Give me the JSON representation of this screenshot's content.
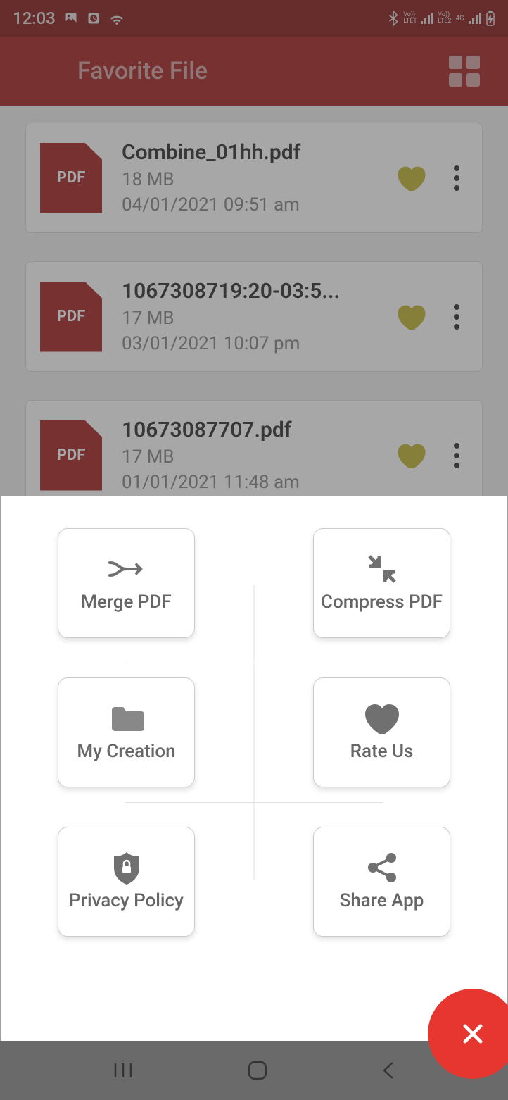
{
  "status": {
    "time": "12:03",
    "icons": {
      "bluetooth": "bluetooth",
      "lte1": "LTE1",
      "lte2": "LTE2",
      "network": "4G",
      "battery": "charging"
    }
  },
  "header": {
    "title": "Favorite File"
  },
  "files": [
    {
      "name": "Combine_01hh.pdf",
      "size": "18 MB",
      "date": "04/01/2021 09:51 am",
      "favorite": true,
      "ext": "PDF"
    },
    {
      "name": "1067308719:20-03:5...",
      "size": "17 MB",
      "date": "03/01/2021 10:07 pm",
      "favorite": true,
      "ext": "PDF"
    },
    {
      "name": "10673087707.pdf",
      "size": "17 MB",
      "date": "01/01/2021 11:48 am",
      "favorite": true,
      "ext": "PDF"
    }
  ],
  "sheet": {
    "items": [
      {
        "label": "Merge PDF",
        "icon": "merge"
      },
      {
        "label": "Compress PDF",
        "icon": "compress"
      },
      {
        "label": "My Creation",
        "icon": "folder"
      },
      {
        "label": "Rate Us",
        "icon": "heart"
      },
      {
        "label": "Privacy Policy",
        "icon": "shield"
      },
      {
        "label": "Share App",
        "icon": "share"
      }
    ]
  },
  "colors": {
    "primary": "#a82828",
    "primaryDark": "#8b1f1f",
    "accent": "#e7362f",
    "favorite": "#c4b63a"
  }
}
